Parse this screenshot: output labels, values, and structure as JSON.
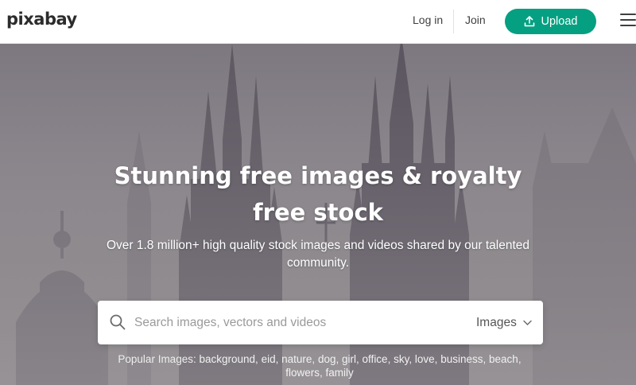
{
  "header": {
    "logo": "pixabay",
    "login_label": "Log in",
    "join_label": "Join",
    "upload_label": "Upload",
    "upload_icon": "upload-icon",
    "menu_icon": "hamburger-menu-icon"
  },
  "hero": {
    "title": "Stunning free images & royalty free stock",
    "subtitle": "Over 1.8 million+ high quality stock images and videos shared by our talented community.",
    "background": "misty church spires silhouette"
  },
  "search": {
    "placeholder": "Search images, vectors and videos",
    "value": "",
    "type_selected": "Images",
    "search_icon": "search-icon"
  },
  "popular": {
    "label": "Popular Images:",
    "tags": [
      "background",
      "eid",
      "nature",
      "dog",
      "girl",
      "office",
      "sky",
      "love",
      "business",
      "beach",
      "flowers",
      "family"
    ]
  },
  "colors": {
    "brand_green": "#05a081",
    "text_dark": "#3f3f3f"
  }
}
